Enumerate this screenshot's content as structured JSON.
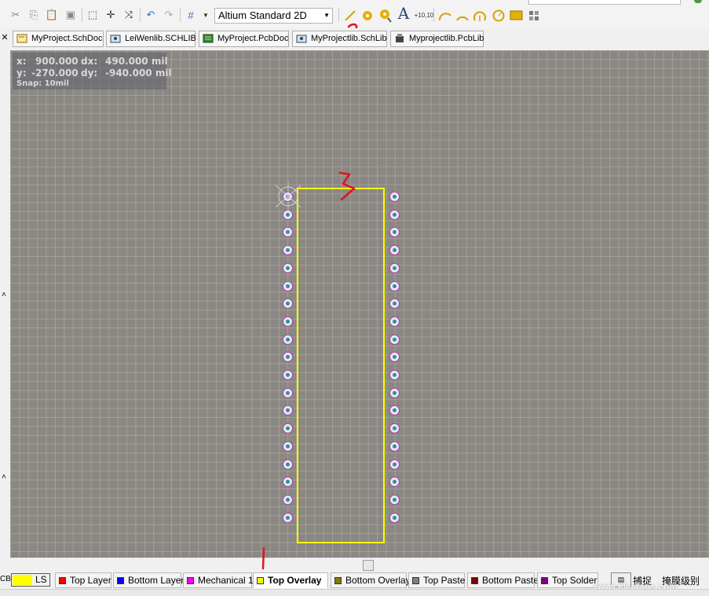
{
  "toolbar": {
    "view_mode": "Altium Standard 2D",
    "text_tool_label": "A",
    "coord_tool_label": "+10,10",
    "icons": [
      "cut-icon",
      "copy-icon",
      "paste-icon",
      "rubber-stamp-icon",
      "select-rect-icon",
      "move-icon",
      "cross-select-icon",
      "undo-icon",
      "redo-icon",
      "grid-icon",
      "line-icon",
      "pad-icon",
      "via-icon",
      "string-icon",
      "coordinate-icon",
      "arc-center-icon",
      "arc-edge-icon",
      "arc-any-icon",
      "circle-icon",
      "fill-icon",
      "array-paste-icon"
    ]
  },
  "doc_tabs": [
    {
      "label": "MyProject.SchDoc",
      "icon": "schematic-icon"
    },
    {
      "label": "LeiWenlib.SCHLIB",
      "icon": "schlib-icon"
    },
    {
      "label": "MyProject.PcbDoc",
      "icon": "pcb-icon"
    },
    {
      "label": "MyProjectlib.SchLib",
      "icon": "schlib-icon"
    },
    {
      "label": "Myprojectlib.PcbLib",
      "icon": "pcblib-icon"
    }
  ],
  "coords": {
    "x_label": "x:",
    "x_value": "900.000",
    "dx_label": "dx:",
    "dx_value": "490.000 mil",
    "y_label": "y:",
    "y_value": "-270.000",
    "dy_label": "dy:",
    "dy_value": "-940.000 mil",
    "snap": "Snap: 10mil"
  },
  "component": {
    "pins_per_side": 19,
    "pad_color": "#b03ab0",
    "hole_color": "#1a9a9a",
    "outline_color": "#ffff00"
  },
  "canvas_colors": {
    "background": "#8b8782",
    "grid": "#aaa7a3"
  },
  "annotations": [
    "1",
    "2",
    "3"
  ],
  "layer_tabs": [
    {
      "label": "LS",
      "color": "#ffff00"
    },
    {
      "label": "Top Layer",
      "color": "#ff0000"
    },
    {
      "label": "Bottom Layer",
      "color": "#0000ff"
    },
    {
      "label": "Mechanical 1",
      "color": "#ff00ff"
    },
    {
      "label": "Top Overlay",
      "color": "#ffff00",
      "active": true
    },
    {
      "label": "Bottom Overlay",
      "color": "#808000"
    },
    {
      "label": "Top Paste",
      "color": "#808080"
    },
    {
      "label": "Bottom Paste",
      "color": "#800000"
    },
    {
      "label": "Top Solder",
      "color": "#800080"
    }
  ],
  "layer_bar_right": {
    "snap_label": "捕捉",
    "mask_label": "掩膜级别"
  },
  "left_label": "CB",
  "watermark": "www.elecfans.com"
}
